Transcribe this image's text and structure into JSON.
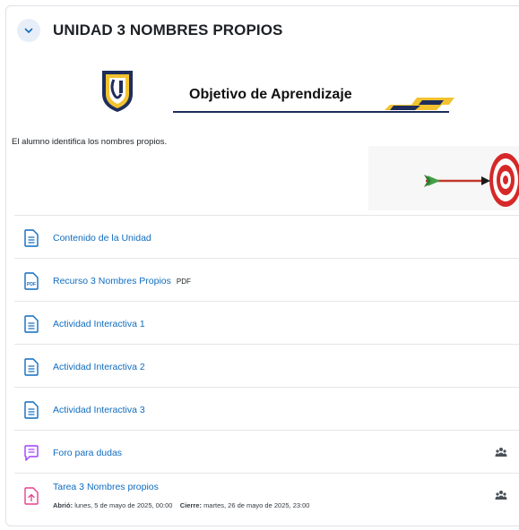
{
  "section": {
    "title": "UNIDAD 3 NOMBRES PROPIOS",
    "banner_title": "Objetivo de Aprendizaje",
    "summary": "El alumno identifica los nombres propios."
  },
  "activities": [
    {
      "name": "Contenido de la Unidad",
      "type": "page"
    },
    {
      "name": "Recurso 3 Nombres Propios",
      "type": "pdf",
      "badge": "PDF",
      "icon_label": "PDF"
    },
    {
      "name": "Actividad Interactiva 1",
      "type": "page"
    },
    {
      "name": "Actividad Interactiva 2",
      "type": "page"
    },
    {
      "name": "Actividad Interactiva 3",
      "type": "page"
    },
    {
      "name": "Foro para dudas",
      "type": "forum"
    },
    {
      "name": "Tarea 3 Nombres propios",
      "type": "assignment",
      "opened_label": "Abrió:",
      "opened": "lunes, 5 de mayo de 2025, 00:00",
      "due_label": "Cierre:",
      "due": "martes, 26 de mayo de 2025, 23:00"
    }
  ],
  "colors": {
    "link": "#0f6cbf",
    "page_icon": "#0f6cbf",
    "forum_icon": "#a03eff",
    "assignment_icon": "#e83e8c",
    "collapse_bg": "#e7eef8"
  }
}
